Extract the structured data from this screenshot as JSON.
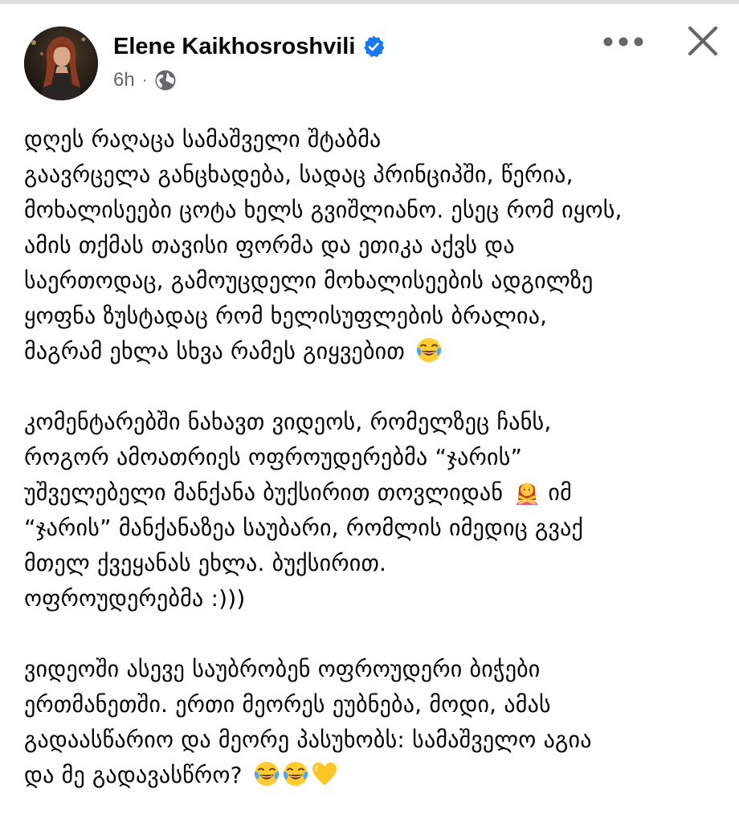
{
  "post": {
    "author": {
      "name": "Elene Kaikhosroshvili",
      "verified": true
    },
    "time": "6h",
    "separator": "·",
    "audience_icon": "globe-icon",
    "header_actions": [
      "more-options-icon",
      "close-icon"
    ],
    "accent_color": "#1877f2",
    "paragraphs": [
      {
        "lines": [
          "დღეს რაღაცა სამაშველი შტაბმა",
          "გაავრცელა განცხადება, სადაც პრინციპში, წერია,",
          "მოხალისეები ცოტა ხელს გვიშლიანო. ესეც რომ იყოს,",
          "ამის თქმას თავისი ფორმა და ეთიკა აქვს და",
          "საერთოდაც, გამოუცდელი მოხალისეების ადგილზე",
          "ყოფნა ზუსტადაც რომ ხელისუფლების ბრალია,",
          "მაგრამ ეხლა სხვა რამეს გიყვებით"
        ],
        "trailing_emojis": [
          "face-with-tears-of-joy"
        ]
      },
      {
        "lines": [
          "კომენტარებში ნახავთ ვიდეოს, რომელზეც ჩანს,",
          "როგორ ამოათრიეს ოფროუდერებმა “ჯარის”",
          "უშველებელი მანქანა ბუქსირით თოვლიდან",
          "“ჯარის” მანქანაზეა საუბარი, რომლის იმედიც გვაქ",
          "მთელ ქვეყანას ეხლა. ბუქსირით.",
          "ოფროუდერებმა :)))"
        ],
        "line3_emoji": "woman-gesturing-no",
        "line3_suffix": "იმ"
      },
      {
        "lines": [
          "ვიდეოში ასევე საუბრობენ ოფროუდერი ბიჭები",
          "ერთმანეთში. ერთი მეორეს ეუბნება, მოდი, ამას",
          "გადაასწარიო და მეორე პასუხობს: სამაშველო აგია",
          "და მე გადავასწრო?"
        ],
        "trailing_emojis": [
          "face-with-tears-of-joy",
          "face-with-tears-of-joy",
          "yellow-heart"
        ]
      }
    ]
  }
}
